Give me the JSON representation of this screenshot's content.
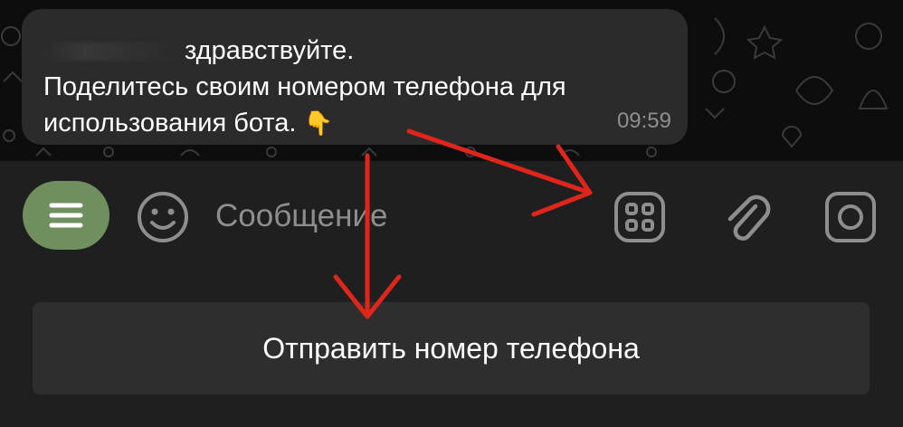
{
  "message": {
    "line1": "здравствуйте.",
    "line2": "Поделитесь своим номером телефона для",
    "line3": "использования бота.",
    "emoji": "👇",
    "time": "09:59"
  },
  "composer": {
    "placeholder": "Сообщение",
    "menu_icon": "menu-icon",
    "emoji_icon": "smile-icon",
    "bot_commands_icon": "grid-icon",
    "attach_icon": "paperclip-icon",
    "camera_icon": "camera-icon"
  },
  "reply_keyboard": {
    "button_label": "Отправить номер телефона"
  },
  "colors": {
    "accent": "#6f8f5f",
    "annotation": "#e0261b",
    "bubble": "#2b2b2b",
    "background": "#1f1f1f"
  }
}
